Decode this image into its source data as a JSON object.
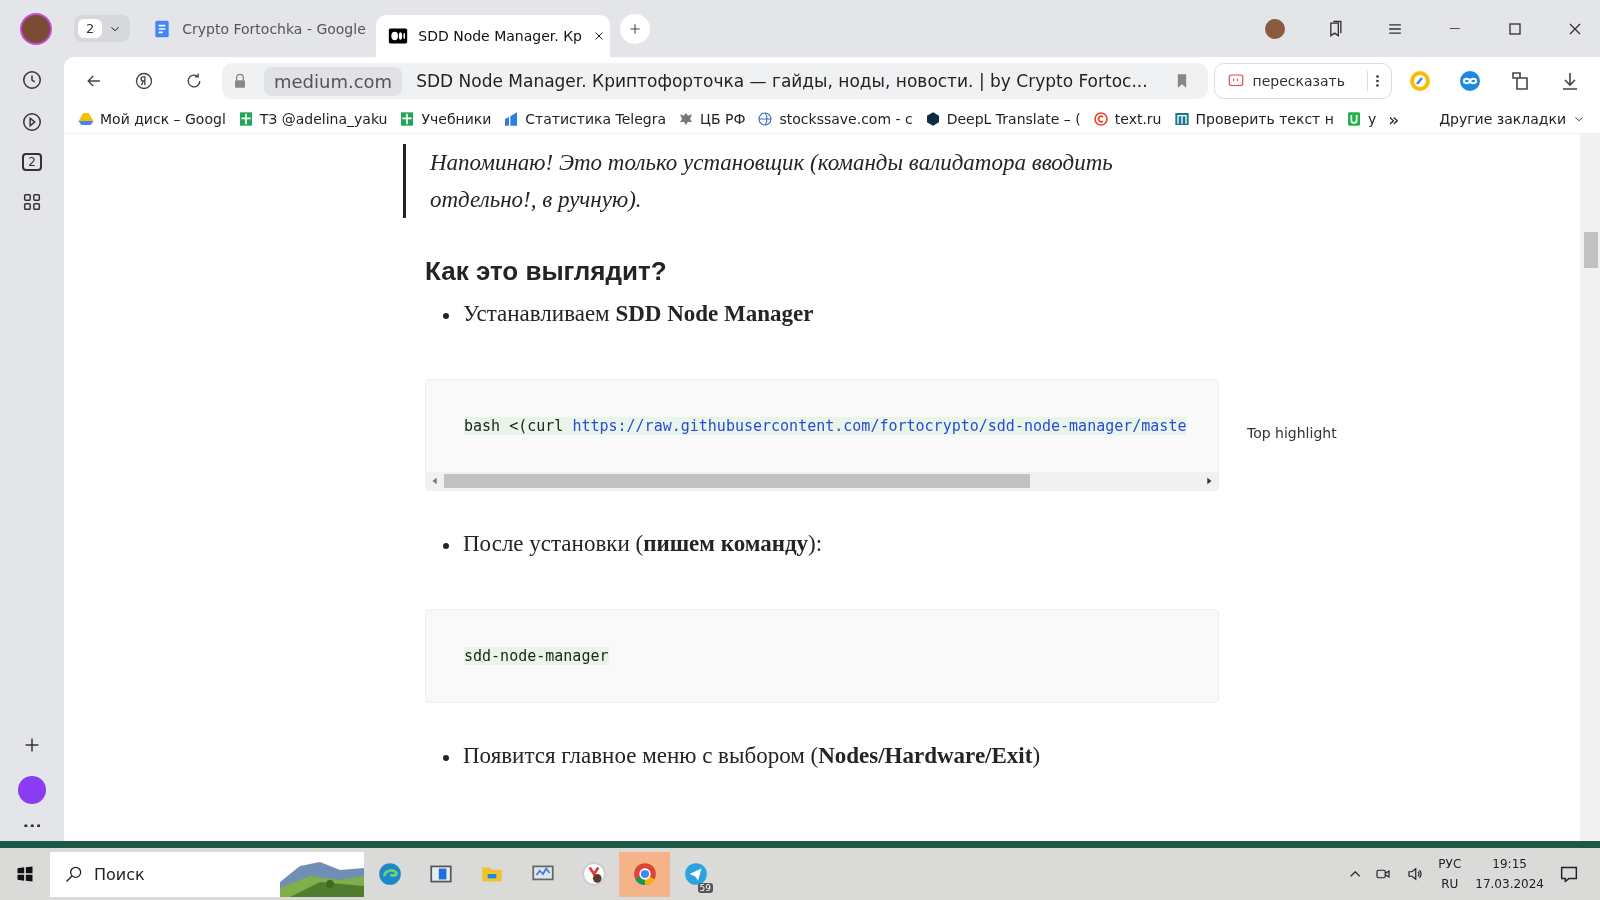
{
  "browser": {
    "tab_group_count": "2",
    "tabs": [
      {
        "title": "Crypto Fortochka - Google",
        "kind": "docs",
        "selected": false
      },
      {
        "title": "SDD Node Manager. Кр",
        "kind": "medium",
        "selected": true
      }
    ],
    "address": {
      "domain": "medium.com",
      "title": "SDD Node Manager. Криптофорточка — гайды, ноды, новости. | by Crypto Fortoc..."
    },
    "retell_button": "пересказать",
    "bookmarks": [
      {
        "label": "Мой диск – Googl",
        "kind": "drive"
      },
      {
        "label": "ТЗ @adelina_yaku",
        "kind": "sheet"
      },
      {
        "label": "Учебники",
        "kind": "sheet"
      },
      {
        "label": "Статистика Telegra",
        "kind": "stats"
      },
      {
        "label": "ЦБ РФ",
        "kind": "eagle"
      },
      {
        "label": "stockssave.com - c",
        "kind": "globe"
      },
      {
        "label": "DeepL Translate – (",
        "kind": "deepl"
      },
      {
        "label": "text.ru",
        "kind": "textru"
      },
      {
        "label": "Проверить текст н",
        "kind": "mtext"
      },
      {
        "label": "y",
        "kind": "utext"
      }
    ],
    "bookmarks_overflow": "»",
    "other_bookmarks": "Другие закладки"
  },
  "sidebar": {
    "tab_count": "2"
  },
  "article": {
    "blocks": [
      {
        "kind": "quote",
        "text": "Напоминаю! Это только установщик (команды валидатора вводить отдельно!, в ручную)."
      },
      {
        "kind": "heading",
        "text": "Как это выглядит?"
      },
      {
        "kind": "bullet",
        "text": "Устанавливаем **SDD Node Manager**"
      },
      {
        "kind": "code",
        "text": "bash <(curl ",
        "link": "https://raw.githubusercontent.com/fortocrypto/sdd-node-manager/maste",
        "scrollable": true,
        "side_note": "Top highlight"
      },
      {
        "kind": "bullet",
        "text": "После установки (**пишем команду**):"
      },
      {
        "kind": "code",
        "text": "sdd-node-manager",
        "scrollable": false
      },
      {
        "kind": "bullet",
        "text": "Появится главное меню с выбором (**Nodes/Hardware/Exit**)"
      }
    ]
  },
  "taskbar": {
    "search_placeholder": "Поиск",
    "telegram_badge": "59",
    "language": "РУС",
    "region": "RU",
    "time": "19:15",
    "date": "17.03.2024"
  }
}
